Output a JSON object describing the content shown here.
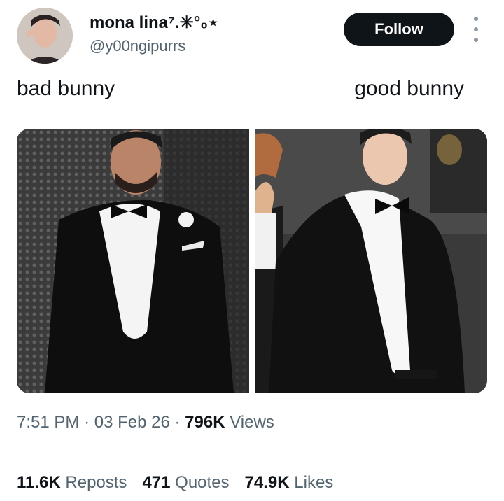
{
  "author": {
    "name": "mona lina⁷.✳︎°₀⋆",
    "handle": "@y00ngipurrs"
  },
  "follow_label": "Follow",
  "captions": {
    "left": "bad bunny",
    "right": "good bunny"
  },
  "tweet_meta": {
    "time": "7:51 PM",
    "separator": "·",
    "date": "03 Feb 26",
    "views_count": "796K",
    "views_label": "Views"
  },
  "stats": {
    "reposts_count": "11.6K",
    "reposts_label": "Reposts",
    "quotes_count": "471",
    "quotes_label": "Quotes",
    "likes_count": "74.9K",
    "likes_label": "Likes"
  },
  "colors": {
    "text": "#0f1419",
    "muted": "#536471",
    "button_bg": "#0f1419",
    "divider": "#dfe3e6"
  },
  "icons": {
    "more": "more-vertical-icon"
  }
}
